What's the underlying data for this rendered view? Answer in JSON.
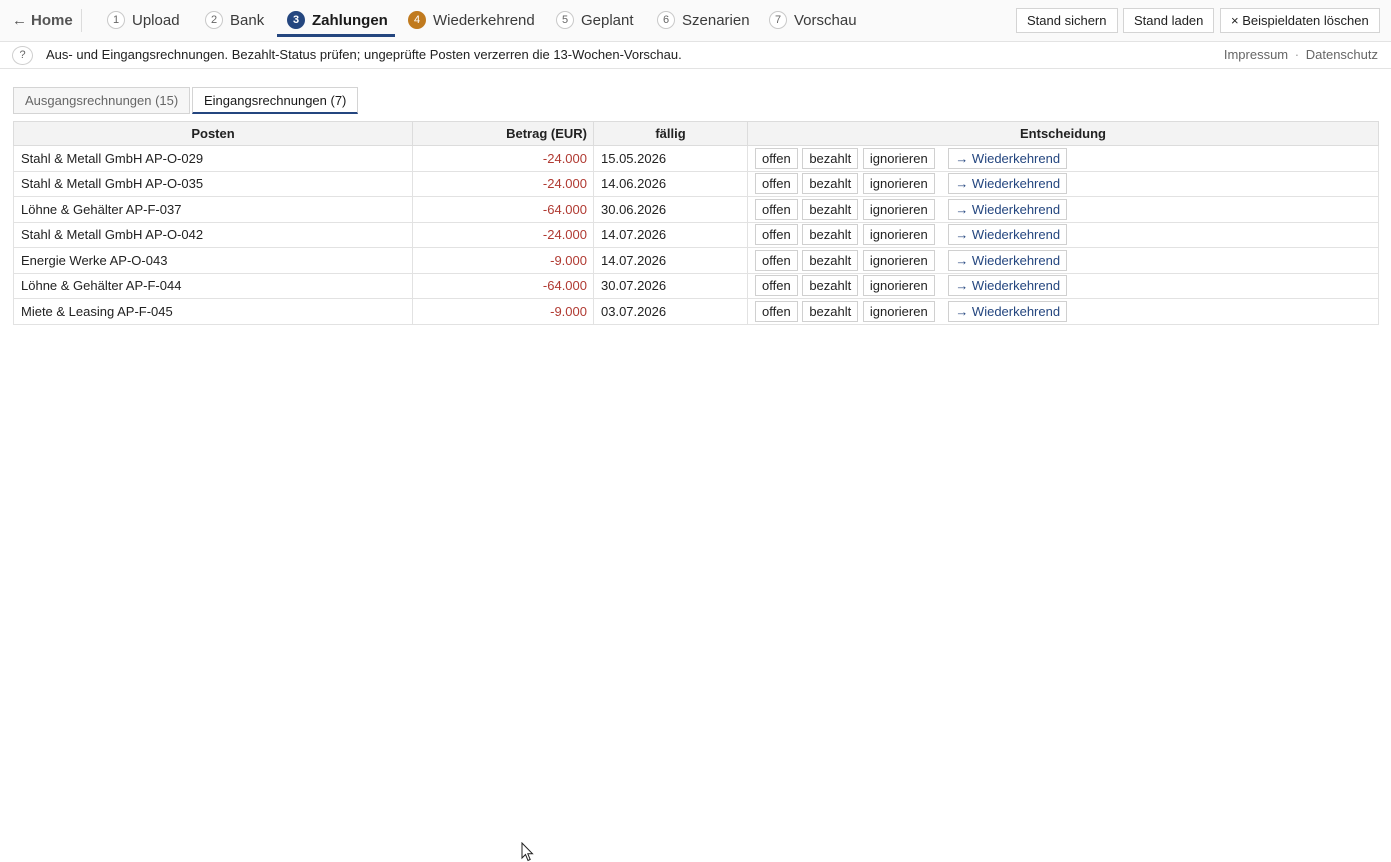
{
  "nav": {
    "home_arrow": "←",
    "home_label": "Home",
    "steps": [
      {
        "num": "1",
        "label": "Upload"
      },
      {
        "num": "2",
        "label": "Bank"
      },
      {
        "num": "3",
        "label": "Zahlungen"
      },
      {
        "num": "4",
        "label": "Wiederkehrend"
      },
      {
        "num": "5",
        "label": "Geplant"
      },
      {
        "num": "6",
        "label": "Szenarien"
      },
      {
        "num": "7",
        "label": "Vorschau"
      }
    ],
    "active_color": "#24467f",
    "warn_color": "#c07a1e"
  },
  "actions": {
    "save_label": "Stand sichern",
    "load_label": "Stand laden",
    "clear_icon": "×",
    "clear_label": "Beispieldaten löschen"
  },
  "info": {
    "help_icon": "?",
    "text": "Aus- und Eingangsrechnungen. Bezahlt-Status prüfen; ungeprüfte Posten verzerren die 13-Wochen-Vorschau.",
    "impressum": "Impressum",
    "sep": "·",
    "datenschutz": "Datenschutz"
  },
  "tabs": {
    "outgoing": "Ausgangsrechnungen (15)",
    "incoming": "Eingangsrechnungen (7)"
  },
  "table": {
    "headers": {
      "posten": "Posten",
      "betrag": "Betrag (EUR)",
      "faellig": "fällig",
      "entscheidung": "Entscheidung"
    },
    "decision_labels": {
      "open": "offen",
      "paid": "bezahlt",
      "ignore": "ignorieren",
      "recurring": "→ Wiederkehrend"
    },
    "rows": [
      {
        "posten": "Stahl & Metall GmbH AP-O-029",
        "betrag": "-24.000",
        "faellig": "15.05.2026"
      },
      {
        "posten": "Stahl & Metall GmbH AP-O-035",
        "betrag": "-24.000",
        "faellig": "14.06.2026"
      },
      {
        "posten": "Löhne & Gehälter AP-F-037",
        "betrag": "-64.000",
        "faellig": "30.06.2026"
      },
      {
        "posten": "Stahl & Metall GmbH AP-O-042",
        "betrag": "-24.000",
        "faellig": "14.07.2026"
      },
      {
        "posten": "Energie Werke AP-O-043",
        "betrag": "-9.000",
        "faellig": "14.07.2026"
      },
      {
        "posten": "Löhne & Gehälter AP-F-044",
        "betrag": "-64.000",
        "faellig": "30.07.2026"
      },
      {
        "posten": "Miete & Leasing AP-F-045",
        "betrag": "-9.000",
        "faellig": "03.07.2026"
      }
    ],
    "negative_color": "#b03a32"
  }
}
